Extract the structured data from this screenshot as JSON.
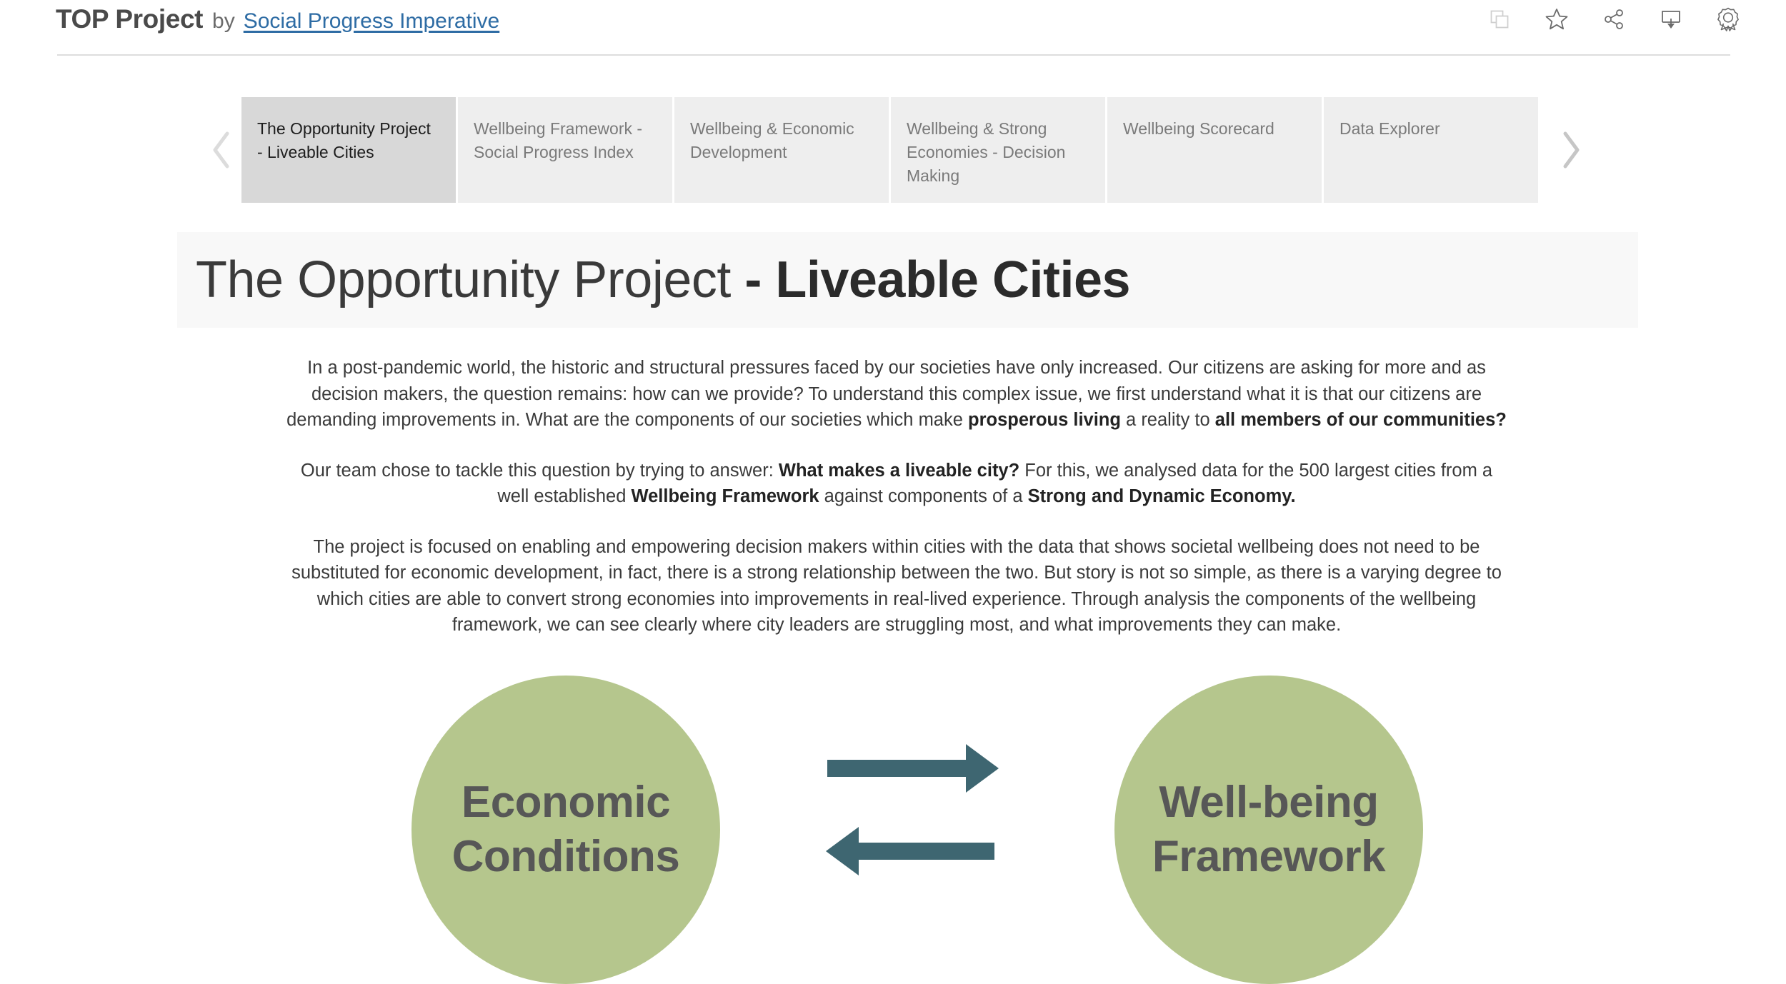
{
  "header": {
    "title_main": "TOP Project",
    "title_by": "by",
    "title_link": "Social Progress Imperative",
    "icons": [
      {
        "name": "copy-icon",
        "label": "Copy"
      },
      {
        "name": "star-icon",
        "label": "Favorite"
      },
      {
        "name": "share-icon",
        "label": "Share"
      },
      {
        "name": "download-icon",
        "label": "Download"
      },
      {
        "name": "badge-icon",
        "label": "Badge"
      }
    ]
  },
  "tabs": {
    "prev_arrow": "‹",
    "next_arrow": "›",
    "items": [
      {
        "label": "The Opportunity Project - Liveable Cities",
        "active": true
      },
      {
        "label": "Wellbeing Framework - Social Progress Index",
        "active": false
      },
      {
        "label": "Wellbeing & Economic Development",
        "active": false
      },
      {
        "label": "Wellbeing & Strong Economies - Decision Making",
        "active": false
      },
      {
        "label": "Wellbeing Scorecard",
        "active": false
      },
      {
        "label": "Data Explorer",
        "active": false
      }
    ]
  },
  "title_banner": {
    "light_part": "The Opportunity Project ",
    "bold_part": "- Liveable Cities"
  },
  "body": {
    "paragraph_1_a": "In a post-pandemic world, the historic and structural pressures faced by our societies have only increased. Our citizens are asking for more and as decision makers, the question remains: how can we provide? To understand this complex issue, we first understand what it is that our citizens are demanding improvements in. What are the components of our societies which make ",
    "paragraph_1_b": "prosperous living",
    "paragraph_1_c": " a reality to ",
    "paragraph_1_d": "all members of our communities?",
    "paragraph_2_a": "Our team chose to tackle this question by trying to answer: ",
    "paragraph_2_b": "What makes a liveable city?",
    "paragraph_2_c": " For this, we analysed data for the 500 largest cities from a well established ",
    "paragraph_2_d": "Wellbeing Framework",
    "paragraph_2_e": " against components of a ",
    "paragraph_2_f": "Strong and Dynamic Economy.",
    "paragraph_3": "The project is focused on enabling and empowering decision makers within cities with the data that shows societal wellbeing does not need to be substituted for economic development, in fact, there is a strong relationship between the two. But story is not so simple, as there is a varying degree to which cities are able to convert strong economies into improvements in real-lived experience. Through analysis the components of the wellbeing framework, we can see clearly where city leaders are struggling most, and what improvements they can make."
  },
  "diagram": {
    "left_bubble_line_1": "Economic",
    "left_bubble_line_2": "Conditions",
    "right_bubble_line_1": "Well-being",
    "right_bubble_line_2": "Framework",
    "arrow_right_name": "arrow-right",
    "arrow_left_name": "arrow-left"
  },
  "colors": {
    "bubble_green": "#b5c68d",
    "arrow_teal": "#3e6671",
    "link_blue": "#2e6ca4",
    "active_tab_bg": "#d8d8d8",
    "tab_bg": "#eeeeee",
    "banner_bg": "#f8f8f8"
  }
}
